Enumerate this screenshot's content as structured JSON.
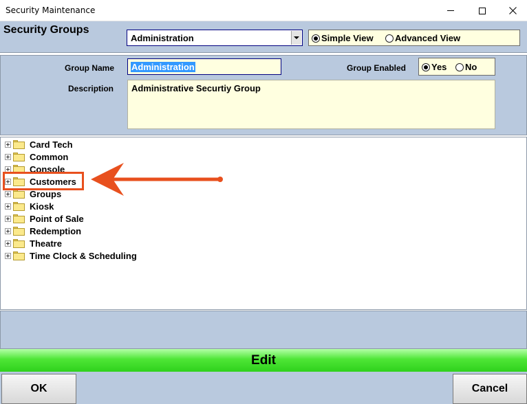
{
  "window": {
    "title": "Security Maintenance"
  },
  "header": {
    "title": "Security Groups",
    "group_select_value": "Administration",
    "view_options": [
      {
        "label": "Simple View",
        "selected": true
      },
      {
        "label": "Advanced View",
        "selected": false
      }
    ]
  },
  "details": {
    "group_name_label": "Group Name",
    "group_name_value": "Administration",
    "group_enabled_label": "Group Enabled",
    "enabled_options": [
      {
        "label": "Yes",
        "selected": true
      },
      {
        "label": "No",
        "selected": false
      }
    ],
    "description_label": "Description",
    "description_value": "Administrative Securtiy Group"
  },
  "tree": {
    "items": [
      {
        "label": "Card Tech"
      },
      {
        "label": "Common"
      },
      {
        "label": "Console"
      },
      {
        "label": "Customers",
        "highlighted": true
      },
      {
        "label": "Groups"
      },
      {
        "label": "Kiosk"
      },
      {
        "label": "Point of Sale"
      },
      {
        "label": "Redemption"
      },
      {
        "label": "Theatre"
      },
      {
        "label": "Time Clock & Scheduling"
      }
    ]
  },
  "status_bar": {
    "mode_label": "Edit"
  },
  "footer": {
    "ok_label": "OK",
    "cancel_label": "Cancel"
  },
  "colors": {
    "panel_bg": "#b9c9de",
    "field_bg": "#ffffe0",
    "edit_bar_green": "#3fe02a",
    "annotation_orange": "#e8501e",
    "selection_blue": "#3399ff"
  }
}
